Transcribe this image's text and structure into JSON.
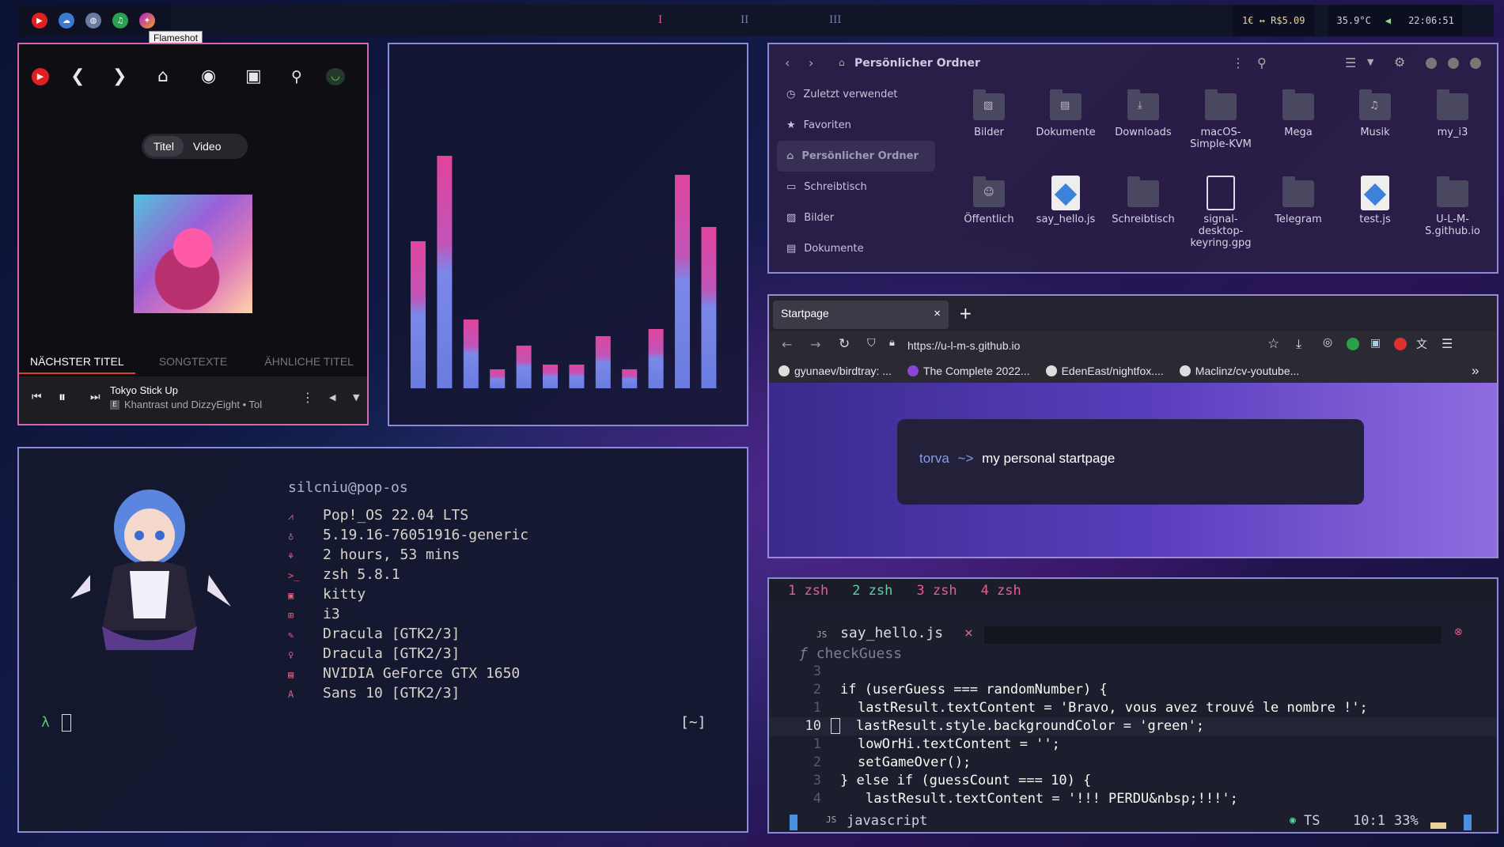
{
  "topbar": {
    "tray_icons": [
      "youtube-music-icon",
      "cloud-icon",
      "globe-icon",
      "headset-icon",
      "flameshot-icon"
    ],
    "workspaces": [
      "I",
      "II",
      "III"
    ],
    "currency": "1€ ↔ R$5.09",
    "temperature": "35.9°C",
    "volume_icon": "speaker-icon",
    "clock": "22:06:51",
    "tooltip": "Flameshot"
  },
  "ytmusic": {
    "segment": [
      "Titel",
      "Video"
    ],
    "tabs": [
      "NÄCHSTER TITEL",
      "SONGTEXTE",
      "ÄHNLICHE TITEL"
    ],
    "track_title": "Tokyo Stick Up",
    "track_artist": "Khantrast und DizzyEight • Tol",
    "explicit_badge": "E"
  },
  "cava": {
    "levels": [
      0.62,
      0.98,
      0.29,
      0.08,
      0.18,
      0.1,
      0.1,
      0.22,
      0.08,
      0.25,
      0.9,
      0.68
    ]
  },
  "files": {
    "title": "Persönlicher Ordner",
    "sidebar": [
      {
        "icon": "clock-icon",
        "label": "Zuletzt verwendet"
      },
      {
        "icon": "star-icon",
        "label": "Favoriten"
      },
      {
        "icon": "home-icon",
        "label": "Persönlicher Ordner"
      },
      {
        "icon": "desktop-icon",
        "label": "Schreibtisch"
      },
      {
        "icon": "image-icon",
        "label": "Bilder"
      },
      {
        "icon": "document-icon",
        "label": "Dokumente"
      }
    ],
    "items": [
      {
        "name": "Bilder",
        "kind": "folder"
      },
      {
        "name": "Dokumente",
        "kind": "folder"
      },
      {
        "name": "Downloads",
        "kind": "folder"
      },
      {
        "name": "macOS-Simple-KVM",
        "kind": "folder"
      },
      {
        "name": "Mega",
        "kind": "folder"
      },
      {
        "name": "Musik",
        "kind": "folder"
      },
      {
        "name": "my_i3",
        "kind": "folder"
      },
      {
        "name": "Öffentlich",
        "kind": "folder"
      },
      {
        "name": "say_hello.js",
        "kind": "js"
      },
      {
        "name": "Schreibtisch",
        "kind": "folder"
      },
      {
        "name": "signal-desktop-keyring.gpg",
        "kind": "file"
      },
      {
        "name": "Telegram",
        "kind": "folder"
      },
      {
        "name": "test.js",
        "kind": "js"
      },
      {
        "name": "U-L-M-S.github.io",
        "kind": "folder"
      }
    ]
  },
  "browser": {
    "tab_title": "Startpage",
    "new_tab": "+",
    "close": "×",
    "url": "https://u-l-m-s.github.io",
    "bookmarks": [
      "gyunaev/birdtray: ...",
      "The Complete 2022...",
      "EdenEast/nightfox....",
      "Maclinz/cv-youtube..."
    ],
    "overflow": "»",
    "start_user": "torva",
    "start_arrow": "~>",
    "start_text": "my personal startpage"
  },
  "terminal": {
    "user_host": "silcniu@pop-os",
    "info": [
      {
        "icon": "os-icon",
        "value": "Pop!_OS 22.04 LTS"
      },
      {
        "icon": "kernel-icon",
        "value": "5.19.16-76051916-generic"
      },
      {
        "icon": "uptime-icon",
        "value": "2 hours, 53 mins"
      },
      {
        "icon": "shell-icon",
        "value": "zsh 5.8.1"
      },
      {
        "icon": "terminal-icon",
        "value": "kitty"
      },
      {
        "icon": "wm-icon",
        "value": "i3"
      },
      {
        "icon": "theme-icon",
        "value": "Dracula [GTK2/3]"
      },
      {
        "icon": "icons-icon",
        "value": "Dracula [GTK2/3]"
      },
      {
        "icon": "gpu-icon",
        "value": "NVIDIA GeForce GTX 1650"
      },
      {
        "icon": "font-icon",
        "value": "Sans 10 [GTK2/3]"
      }
    ],
    "prompt": "λ",
    "cwd": "[~]"
  },
  "vim": {
    "tmux_windows": [
      "1 zsh",
      "2 zsh",
      "3 zsh",
      "4 zsh"
    ],
    "buffer_name": "say_hello.js",
    "buffer_close": "×",
    "function_name": "checkGuess",
    "lines": [
      {
        "num": "3",
        "code": ""
      },
      {
        "num": "2",
        "code": "if (userGuess === randomNumber) {"
      },
      {
        "num": "1",
        "code": "lastResult.textContent = 'Bravo, vous avez trouvé le nombre !';"
      },
      {
        "num": "10",
        "code": "lastResult.style.backgroundColor = 'green';"
      },
      {
        "num": "1",
        "code": "lowOrHi.textContent = '';"
      },
      {
        "num": "2",
        "code": "setGameOver();"
      },
      {
        "num": "3",
        "code": "} else if (guessCount === 10) {"
      },
      {
        "num": "4",
        "code": "lastResult.textContent = '!!! PERDU&nbsp;!!!';"
      }
    ],
    "filetype": "javascript",
    "lsp": "TS",
    "position": "10:1",
    "percent": "33%"
  }
}
